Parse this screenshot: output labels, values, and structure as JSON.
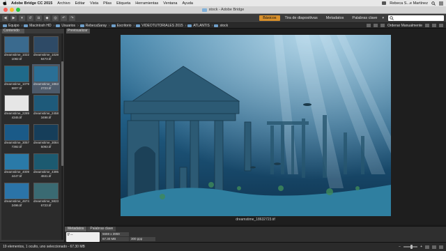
{
  "menubar": {
    "app": "Adobe Bridge CC 2015",
    "items": [
      "Archivo",
      "Editar",
      "Vista",
      "Pilas",
      "Etiqueta",
      "Herramientas",
      "Ventana",
      "Ayuda"
    ],
    "user": "Rebeca S...e Martínez",
    "icons": [
      "apple-icon",
      "wifi-icon",
      "search-icon",
      "list-icon"
    ]
  },
  "window": {
    "title": "stock - Adobe Bridge"
  },
  "toolbar": {
    "workspaces": [
      "Básicos",
      "Tira de diapositivas",
      "Metadatos",
      "Palabras clave"
    ],
    "active_workspace": "Básicos",
    "search_placeholder": "",
    "workspace_menu_icon": "chevron-down-icon"
  },
  "pathbar": {
    "crumbs": [
      "Equipo",
      "Macintosh HD",
      "Usuarios",
      "RebecaSaray",
      "Escritorio",
      "VIDEOTUTORIALES 2015",
      "ATLANTIS",
      "stock"
    ],
    "sort_label": "Ordenar Manualmente"
  },
  "content_panel": {
    "tab": "Contenido",
    "thumbnails": [
      {
        "name1": "dreamstime_1022",
        "name2": "1082.tif",
        "color": "#3a6a8e"
      },
      {
        "name1": "dreamstime_1028",
        "name2": "8473.tif",
        "color": "#2e4a66"
      },
      {
        "name1": "dreamstime_1079",
        "name2": "5807.tif",
        "color": "#1f6a8a"
      },
      {
        "name1": "dreamstime_1863",
        "name2": "2723.tif",
        "color": "#2a6f96",
        "selected": true
      },
      {
        "name1": "dreamstime_2289",
        "name2": "4345.tif",
        "color": "#e6e6e6"
      },
      {
        "name1": "dreamstime_2458",
        "name2": "3498.tif",
        "color": "#1e5a7a"
      },
      {
        "name1": "dreamstime_3057",
        "name2": "7392.tif",
        "color": "#1a5a88"
      },
      {
        "name1": "dreamstime_3084",
        "name2": "5093.tif",
        "color": "#163e5a"
      },
      {
        "name1": "dreamstime_4009",
        "name2": "4447.tif",
        "color": "#2a7aa8"
      },
      {
        "name1": "dreamstime_4395",
        "name2": "4841.tif",
        "color": "#1c5a70"
      },
      {
        "name1": "dreamstime_4674",
        "name2": "2496.tif",
        "color": "#2b74a8"
      },
      {
        "name1": "dreamstime_5823",
        "name2": "6723.tif",
        "color": "#3a6a72"
      }
    ]
  },
  "preview": {
    "tab": "Previsualizar",
    "caption": "dreamstime_18632723.tif"
  },
  "metadata": {
    "tabs": [
      "Metadatos",
      "Palabras clave"
    ],
    "fstop": "f/ --",
    "dimensions": "5659 x 3959",
    "size": "67.30 MB",
    "ppp": "300 ppp"
  },
  "status": {
    "text": "19 elementos, 1 oculto, uno seleccionado - 67.30 MB"
  }
}
